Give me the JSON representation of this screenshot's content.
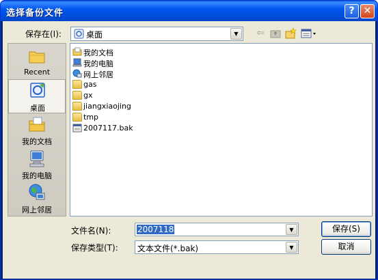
{
  "window": {
    "title": "选择备份文件",
    "help_glyph": "?",
    "close_glyph": "✕"
  },
  "save_in": {
    "label": "保存在(I):",
    "value": "桌面"
  },
  "places": [
    {
      "label": "Recent",
      "icon": "recent-folder-icon"
    },
    {
      "label": "桌面",
      "icon": "desktop-icon",
      "selected": true
    },
    {
      "label": "我的文档",
      "icon": "my-documents-icon"
    },
    {
      "label": "我的电脑",
      "icon": "my-computer-icon"
    },
    {
      "label": "网上邻居",
      "icon": "network-places-icon"
    }
  ],
  "files": [
    {
      "name": "我的文档",
      "icon": "my-documents-icon"
    },
    {
      "name": "我的电脑",
      "icon": "my-computer-icon"
    },
    {
      "name": "网上邻居",
      "icon": "network-places-icon"
    },
    {
      "name": "gas",
      "icon": "folder-icon"
    },
    {
      "name": "gx",
      "icon": "folder-icon"
    },
    {
      "name": "jiangxiaojing",
      "icon": "folder-icon"
    },
    {
      "name": "tmp",
      "icon": "folder-icon"
    },
    {
      "name": "2007117.bak",
      "icon": "bak-file-icon"
    }
  ],
  "filename": {
    "label": "文件名(N):",
    "value": "2007118"
  },
  "filetype": {
    "label": "保存类型(T):",
    "value": "文本文件(*.bak)"
  },
  "buttons": {
    "save": "保存(S)",
    "cancel": "取消"
  },
  "colors": {
    "title_bar": "#0054e3",
    "dialog_bg": "#ece9d8",
    "selection": "#316ac5"
  }
}
